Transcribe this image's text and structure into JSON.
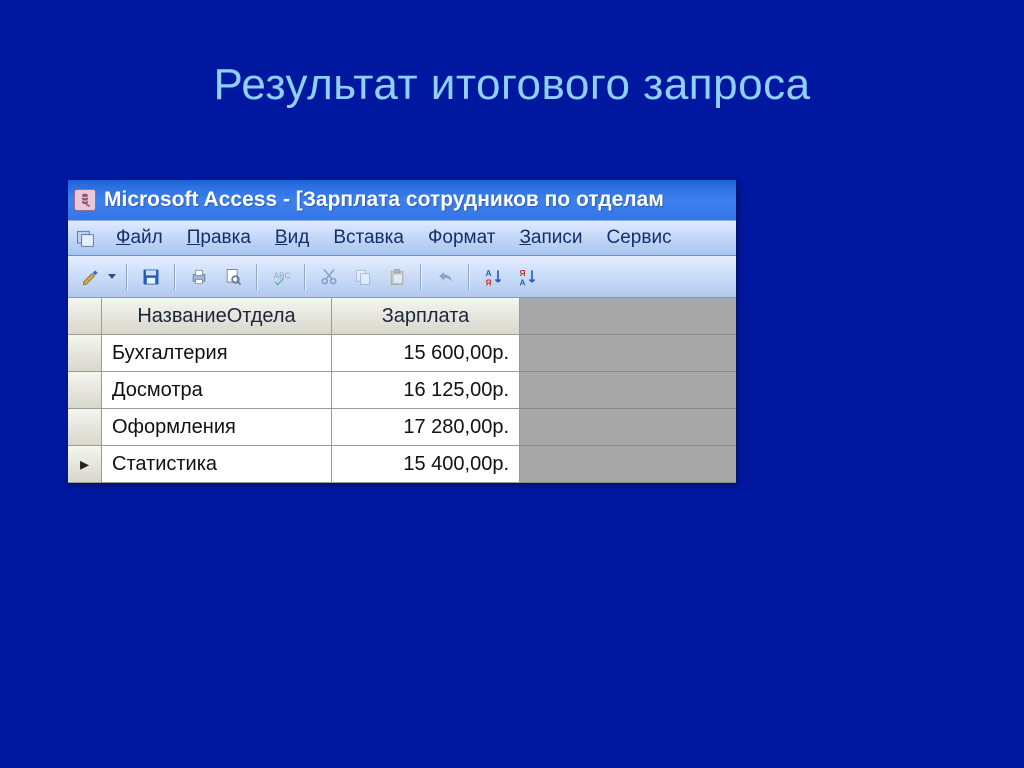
{
  "slide": {
    "title": "Результат итогового запроса"
  },
  "window": {
    "title": "Microsoft Access - [Зарплата сотрудников по отделам"
  },
  "menubar": {
    "items": [
      {
        "label": "Файл",
        "ukey": "Ф"
      },
      {
        "label": "Правка",
        "ukey": "П"
      },
      {
        "label": "Вид",
        "ukey": "В"
      },
      {
        "label": "Вставка",
        "ukey": ""
      },
      {
        "label": "Формат",
        "ukey": ""
      },
      {
        "label": "Записи",
        "ukey": "З"
      },
      {
        "label": "Сервис",
        "ukey": ""
      }
    ]
  },
  "grid": {
    "columns": [
      "НазваниеОтдела",
      "Зарплата"
    ],
    "rows": [
      {
        "selected": false,
        "cells": [
          "Бухгалтерия",
          "15 600,00р."
        ]
      },
      {
        "selected": false,
        "cells": [
          "Досмотра",
          "16 125,00р."
        ]
      },
      {
        "selected": false,
        "cells": [
          "Оформления",
          "17 280,00р."
        ]
      },
      {
        "selected": true,
        "cells": [
          "Статистика",
          "15 400,00р."
        ]
      }
    ]
  }
}
